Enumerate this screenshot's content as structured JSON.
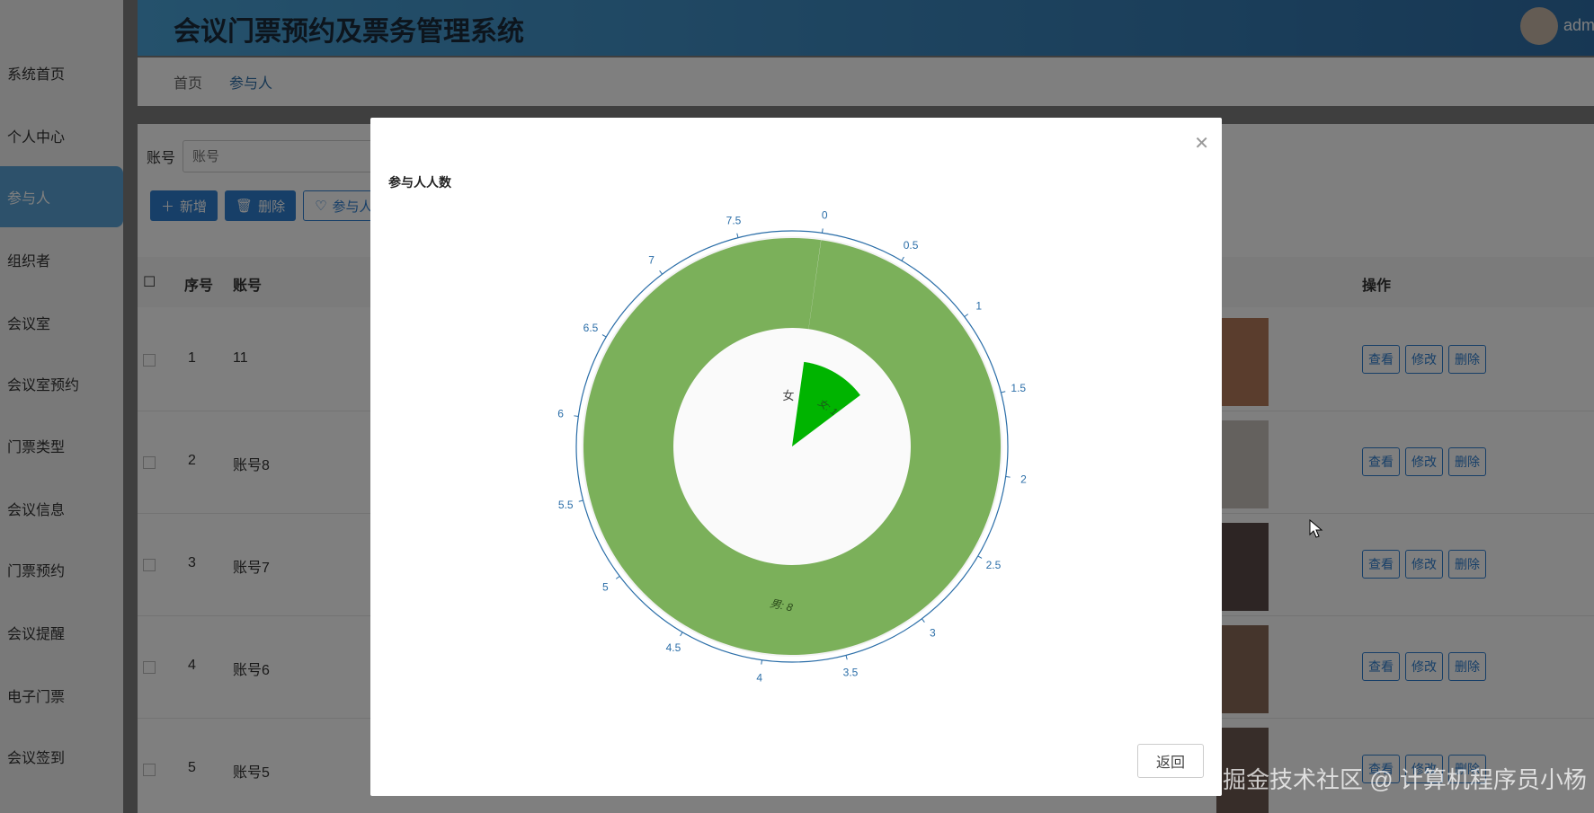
{
  "app": {
    "title": "会议门票预约及票务管理系统",
    "user": "adm"
  },
  "sidebar": {
    "items": [
      {
        "label": "系统首页"
      },
      {
        "label": "个人中心"
      },
      {
        "label": "参与人"
      },
      {
        "label": "组织者"
      },
      {
        "label": "会议室"
      },
      {
        "label": "会议室预约"
      },
      {
        "label": "门票类型"
      },
      {
        "label": "会议信息"
      },
      {
        "label": "门票预约"
      },
      {
        "label": "会议提醒"
      },
      {
        "label": "电子门票"
      },
      {
        "label": "会议签到"
      }
    ]
  },
  "breadcrumb": {
    "home": "首页",
    "current": "参与人"
  },
  "search": {
    "label": "账号",
    "placeholder": "账号"
  },
  "toolbar": {
    "add_label": "新增",
    "delete_label": "删除",
    "stat_label": "参与人"
  },
  "table": {
    "headers": {
      "index": "序号",
      "account": "账号",
      "ops": "操作"
    },
    "rows": [
      {
        "index": "1",
        "account": "11"
      },
      {
        "index": "2",
        "account": "账号8"
      },
      {
        "index": "3",
        "account": "账号7"
      },
      {
        "index": "4",
        "account": "账号6"
      },
      {
        "index": "5",
        "account": "账号5"
      }
    ],
    "op_labels": {
      "view": "查看",
      "edit": "修改",
      "delete": "删除"
    }
  },
  "modal": {
    "chart_title": "参与人人数",
    "back_label": "返回",
    "close_icon": "close-icon"
  },
  "chart_data": {
    "type": "pie",
    "title": "参与人人数",
    "subtype": "polar-bar",
    "categories": [
      "女",
      "男"
    ],
    "values": [
      1,
      8
    ],
    "labels": [
      "女: 1",
      "男: 8"
    ],
    "angle_axis": {
      "min": 0,
      "max": 8,
      "ticks": [
        "0",
        "0.5",
        "1",
        "1.5",
        "2",
        "2.5",
        "3",
        "3.5",
        "4",
        "4.5",
        "5",
        "5.5",
        "6",
        "6.5",
        "7",
        "7.5"
      ]
    },
    "colors": {
      "女": "#00b400",
      "男": "#7bb05a"
    }
  },
  "watermark": "掘金技术社区 @ 计算机程序员小杨"
}
